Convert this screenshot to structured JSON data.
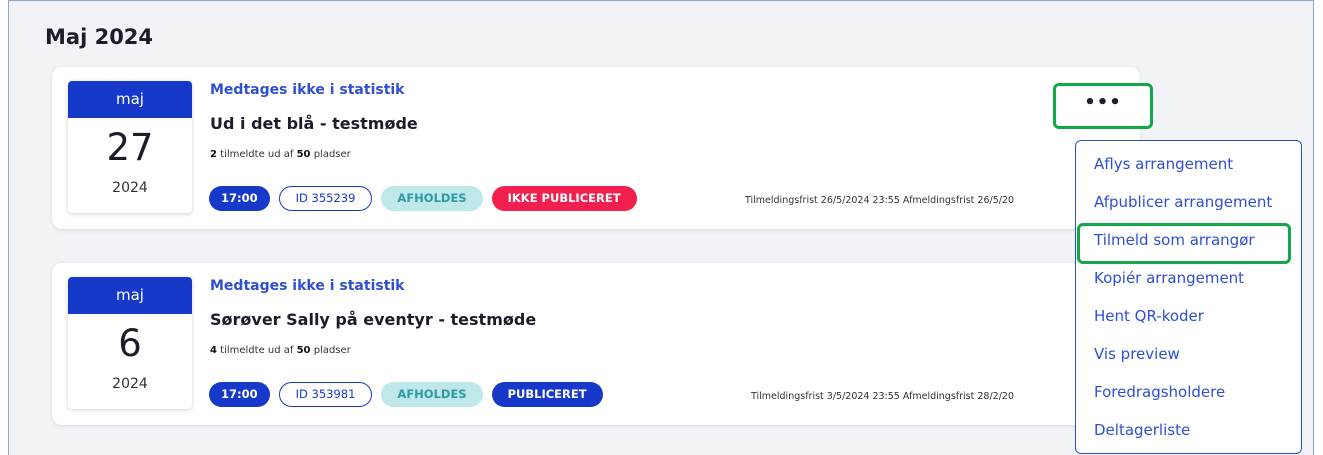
{
  "month_heading": "Maj 2024",
  "events": [
    {
      "date_month": "maj",
      "date_day": "27",
      "date_year": "2024",
      "stat_flag": "Medtages ikke i statistik",
      "title": "Ud i det blå - testmøde",
      "signup_count": "2",
      "signup_text_mid": " tilmeldte ud af ",
      "signup_capacity": "50",
      "signup_text_end": " pladser",
      "time": "17:00",
      "id": "ID 355239",
      "status": "AFHOLDES",
      "publish": "IKKE PUBLICERET",
      "deadlines": "Tilmeldingsfrist 26/5/2024 23:55   Afmeldingsfrist 26/5/20"
    },
    {
      "date_month": "maj",
      "date_day": "6",
      "date_year": "2024",
      "stat_flag": "Medtages ikke i statistik",
      "title": "Sørøver Sally på eventyr - testmøde",
      "signup_count": "4",
      "signup_text_mid": " tilmeldte ud af ",
      "signup_capacity": "50",
      "signup_text_end": " pladser",
      "time": "17:00",
      "id": "ID 353981",
      "status": "AFHOLDES",
      "publish": "PUBLICERET",
      "deadlines": "Tilmeldingsfrist 3/5/2024 23:55   Afmeldingsfrist 28/2/20"
    }
  ],
  "more_button": "•••",
  "context_menu": {
    "items": [
      "Aflys arrangement",
      "Afpublicer arrangement",
      "Tilmeld som arrangør",
      "Kopiér arrangement",
      "Hent QR-koder",
      "Vis preview",
      "Foredragsholdere",
      "Deltagerliste"
    ]
  },
  "colors": {
    "primary": "#1739c9",
    "link": "#2f4fd1",
    "highlight": "#12a84a",
    "unpublished": "#f2204f",
    "status_bg": "#bfe8ea"
  }
}
